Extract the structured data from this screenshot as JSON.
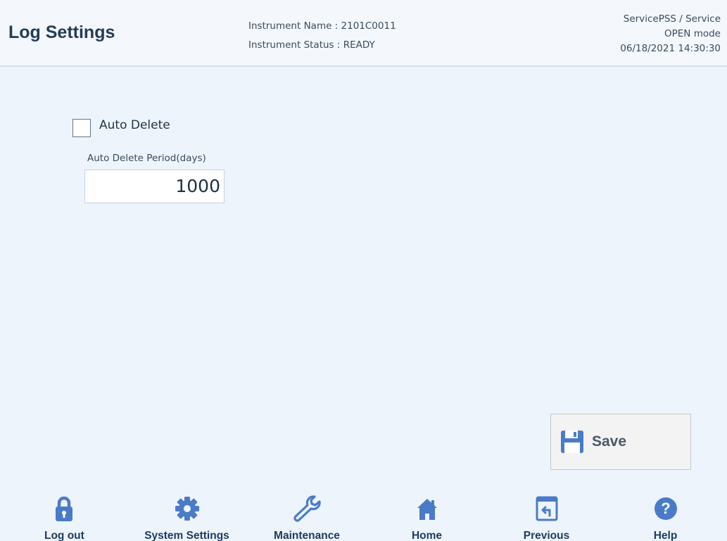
{
  "header": {
    "title": "Log Settings",
    "instrument_name": "Instrument Name : 2101C0011",
    "instrument_status": "Instrument Status : READY",
    "user": "ServicePSS / Service",
    "mode": "OPEN mode",
    "datetime": "06/18/2021 14:30:30"
  },
  "settings": {
    "auto_delete_label": "Auto Delete",
    "auto_delete_checked": false,
    "period_label": "Auto Delete Period(days)",
    "period_value": "1000"
  },
  "actions": {
    "save_label": "Save",
    "save_icon": "floppy-disk-icon"
  },
  "nav": {
    "logout": "Log out",
    "system_settings": "System Settings",
    "maintenance": "Maintenance",
    "home": "Home",
    "previous": "Previous",
    "help": "Help"
  },
  "colors": {
    "background": "#eef4fc",
    "icon": "#4a7bc8",
    "nav_label": "#1e3a5f",
    "title": "#243c58"
  }
}
